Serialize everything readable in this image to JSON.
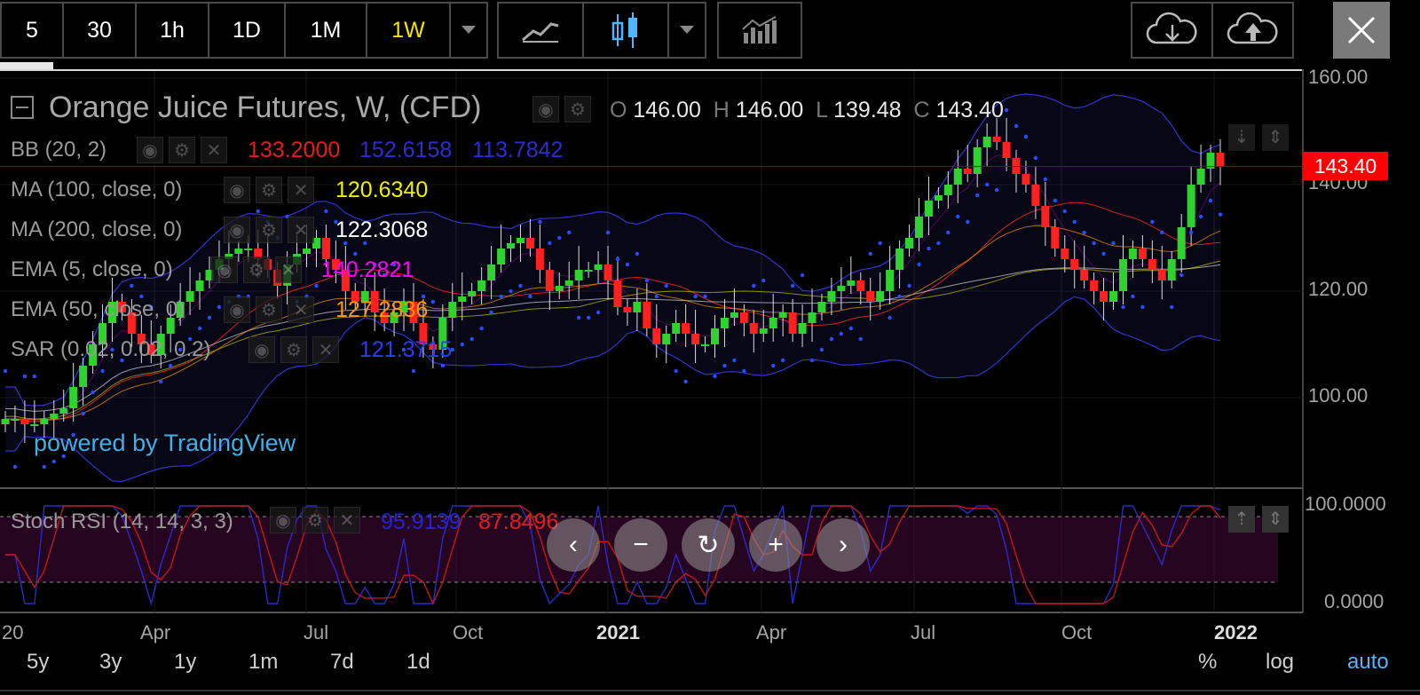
{
  "toolbar": {
    "intervals": [
      "5",
      "30",
      "1h",
      "1D",
      "1M",
      "1W"
    ],
    "active_interval": "1W"
  },
  "symbol": {
    "title": "Orange Juice Futures, W, (CFD)",
    "o_label": "O",
    "o": "146.00",
    "h_label": "H",
    "h": "146.00",
    "l_label": "L",
    "l": "139.48",
    "c_label": "C",
    "c": "143.40",
    "last_price": "143.40"
  },
  "indicators": {
    "bb": {
      "label": "BB (20, 2)",
      "v1": "133.2000",
      "v2": "152.6158",
      "v3": "113.7842"
    },
    "ma100": {
      "label": "MA (100, close, 0)",
      "v": "120.6340"
    },
    "ma200": {
      "label": "MA (200, close, 0)",
      "v": "122.3068"
    },
    "ema5": {
      "label": "EMA (5, close, 0)",
      "v": "140.2821"
    },
    "ema50": {
      "label": "EMA (50, close, 0)",
      "v": "127.2836"
    },
    "sar": {
      "label": "SAR (0.02, 0.02, 0.2)",
      "v": "121.3715"
    },
    "stoch": {
      "label": "Stoch RSI (14, 14, 3, 3)",
      "k": "95.9139",
      "d": "87.8496"
    }
  },
  "watermark": "powered by TradingView",
  "price_axis": [
    "160.00",
    "140.00",
    "120.00",
    "100.00"
  ],
  "stoch_axis": [
    "100.0000",
    "0.0000"
  ],
  "time_axis": [
    "20",
    "Apr",
    "Jul",
    "Oct",
    "2021",
    "Apr",
    "Jul",
    "Oct",
    "2022"
  ],
  "ranges": [
    "5y",
    "3y",
    "1y",
    "1m",
    "7d",
    "1d"
  ],
  "scale_options": {
    "percent": "%",
    "log": "log",
    "auto": "auto"
  },
  "colors": {
    "up": "#2fd22f",
    "down": "#ff2020",
    "bb_mid": "#cc2222",
    "bb_band": "#3333cc",
    "ma100": "#e6e600",
    "ma200": "#ffffff",
    "ema5": "#ff00ff",
    "ema50": "#ff9900",
    "sar": "#2a4cff",
    "accent": "#f2e600",
    "auto": "#4fb6ff",
    "price_tag": "#ff0000"
  },
  "icons": [
    "chevron-down-icon",
    "line-chart-icon",
    "candles-icon",
    "indicators-icon",
    "cloud-download-icon",
    "cloud-upload-icon",
    "close-icon",
    "eye-icon",
    "gear-icon",
    "close-small-icon",
    "collapse-icon",
    "chevron-left-icon",
    "minus-icon",
    "reset-icon",
    "plus-icon",
    "chevron-right-icon"
  ],
  "chart_data": {
    "type": "candlestick",
    "title": "Orange Juice Futures, W, (CFD)",
    "x_ticks": [
      "20",
      "Apr",
      "Jul",
      "Oct",
      "2021",
      "Apr",
      "Jul",
      "Oct",
      "2022"
    ],
    "y_ticks": [
      160,
      140,
      120,
      100
    ],
    "ylim": [
      80,
      162
    ],
    "series": [
      {
        "name": "OHLC",
        "close": [
          96,
          96,
          95,
          95,
          96,
          97,
          98,
          102,
          106,
          110,
          114,
          118,
          116,
          112,
          110,
          108,
          112,
          115,
          118,
          120,
          122,
          124,
          126,
          127,
          128,
          128,
          126,
          124,
          121,
          125,
          127,
          128,
          130,
          126,
          124,
          120,
          118,
          120,
          116,
          114,
          116,
          118,
          114,
          110,
          109,
          115,
          118,
          119,
          120,
          122,
          125,
          128,
          129,
          130,
          128,
          124,
          120,
          121,
          122,
          124,
          124,
          125,
          122,
          117,
          116,
          118,
          113,
          110,
          112,
          114,
          112,
          110,
          110,
          113,
          115,
          116,
          114,
          112,
          113,
          115,
          116,
          112,
          114,
          116,
          118,
          120,
          121,
          122,
          120,
          118,
          120,
          124,
          128,
          130,
          134,
          137,
          138,
          140,
          143,
          142,
          147,
          149,
          148,
          145,
          142,
          140,
          136,
          132,
          128,
          126,
          124,
          122,
          120,
          118,
          120,
          126,
          128,
          126,
          124,
          122,
          126,
          132,
          140,
          143,
          146,
          143.4
        ]
      }
    ],
    "stoch_rsi": {
      "k": 95.9139,
      "d": 87.8496,
      "ylim": [
        0,
        100
      ]
    }
  }
}
